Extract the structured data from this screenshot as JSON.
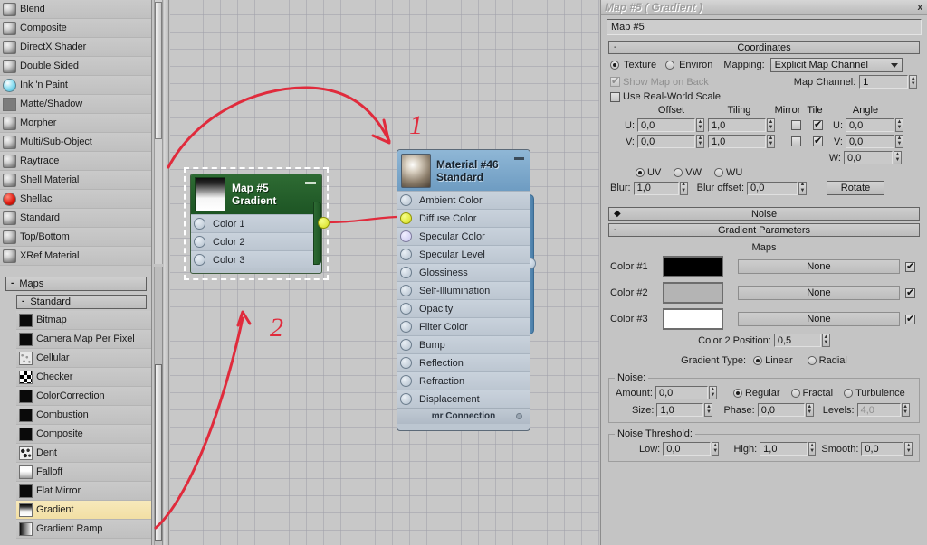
{
  "browser": {
    "materials": [
      {
        "label": "Blend",
        "icon": "sphere-swatch-icon",
        "type": "sphere"
      },
      {
        "label": "Composite",
        "icon": "sphere-swatch-icon",
        "type": "sphere"
      },
      {
        "label": "DirectX Shader",
        "icon": "sphere-swatch-icon",
        "type": "sphere"
      },
      {
        "label": "Double Sided",
        "icon": "sphere-swatch-icon",
        "type": "sphere"
      },
      {
        "label": "Ink 'n Paint",
        "icon": "blue-sphere-swatch-icon",
        "type": "sphere-blue"
      },
      {
        "label": "Matte/Shadow",
        "icon": "gray-swatch-icon",
        "type": "flat-gray"
      },
      {
        "label": "Morpher",
        "icon": "sphere-swatch-icon",
        "type": "sphere"
      },
      {
        "label": "Multi/Sub-Object",
        "icon": "sphere-swatch-icon",
        "type": "sphere"
      },
      {
        "label": "Raytrace",
        "icon": "sphere-swatch-icon",
        "type": "sphere"
      },
      {
        "label": "Shell Material",
        "icon": "sphere-swatch-icon",
        "type": "sphere"
      },
      {
        "label": "Shellac",
        "icon": "red-sphere-swatch-icon",
        "type": "red"
      },
      {
        "label": "Standard",
        "icon": "sphere-swatch-icon",
        "type": "sphere"
      },
      {
        "label": "Top/Bottom",
        "icon": "sphere-swatch-icon",
        "type": "sphere"
      },
      {
        "label": "XRef Material",
        "icon": "sphere-swatch-icon",
        "type": "sphere"
      }
    ],
    "maps_rollout": "Maps",
    "standard_rollout": "Standard",
    "maps": [
      {
        "label": "Bitmap",
        "icon": "black-swatch-icon",
        "type": "black",
        "selected": false
      },
      {
        "label": "Camera Map Per Pixel",
        "icon": "black-swatch-icon",
        "type": "black",
        "selected": false
      },
      {
        "label": "Cellular",
        "icon": "cellular-swatch-icon",
        "type": "cellular",
        "selected": false
      },
      {
        "label": "Checker",
        "icon": "checker-swatch-icon",
        "type": "checker",
        "selected": false
      },
      {
        "label": "ColorCorrection",
        "icon": "black-swatch-icon",
        "type": "black",
        "selected": false
      },
      {
        "label": "Combustion",
        "icon": "black-swatch-icon",
        "type": "black",
        "selected": false
      },
      {
        "label": "Composite",
        "icon": "black-swatch-icon",
        "type": "black",
        "selected": false
      },
      {
        "label": "Dent",
        "icon": "dent-swatch-icon",
        "type": "dent",
        "selected": false
      },
      {
        "label": "Falloff",
        "icon": "falloff-swatch-icon",
        "type": "falloff",
        "selected": false
      },
      {
        "label": "Flat Mirror",
        "icon": "black-swatch-icon",
        "type": "black",
        "selected": false
      },
      {
        "label": "Gradient",
        "icon": "gradient-swatch-icon",
        "type": "gradient",
        "selected": true
      },
      {
        "label": "Gradient Ramp",
        "icon": "gradient-ramp-swatch-icon",
        "type": "gradramp",
        "selected": false
      }
    ]
  },
  "graph": {
    "map_node": {
      "title_line1": "Map #5",
      "title_line2": "Gradient",
      "slots": [
        "Color 1",
        "Color 2",
        "Color 3"
      ]
    },
    "material_node": {
      "title_line1": "Material #46",
      "title_line2": "Standard",
      "slots": [
        "Ambient Color",
        "Diffuse Color",
        "Specular Color",
        "Specular Level",
        "Glossiness",
        "Self-Illumination",
        "Opacity",
        "Filter Color",
        "Bump",
        "Reflection",
        "Refraction",
        "Displacement"
      ],
      "footer": "mr Connection"
    },
    "annotations": [
      {
        "label": "1"
      },
      {
        "label": "2"
      }
    ],
    "annotation_color": "#e02b3c"
  },
  "params": {
    "window_title": "Map #5  ( Gradient )",
    "close_label": "x",
    "name_value": "Map #5",
    "coordinates": {
      "rollout": "Coordinates",
      "texture": "Texture",
      "environ": "Environ",
      "mapping_label": "Mapping:",
      "mapping_value": "Explicit Map Channel",
      "show_map_on_back": "Show Map on Back",
      "map_channel_label": "Map Channel:",
      "map_channel_value": "1",
      "use_real_world_scale": "Use Real-World Scale",
      "offset_header": "Offset",
      "tiling_header": "Tiling",
      "mirror_header": "Mirror",
      "tile_header": "Tile",
      "angle_header": "Angle",
      "u_label": "U:",
      "v_label": "V:",
      "w_label": "W:",
      "offset_u": "0,0",
      "offset_v": "0,0",
      "tiling_u": "1,0",
      "tiling_v": "1,0",
      "angle_u": "0,0",
      "angle_v": "0,0",
      "angle_w": "0,0",
      "mirror_u": false,
      "mirror_v": false,
      "tile_u": true,
      "tile_v": true,
      "uv": "UV",
      "vw": "VW",
      "wu": "WU",
      "axis_selected": "UV",
      "blur_label": "Blur:",
      "blur_value": "1,0",
      "blur_offset_label": "Blur offset:",
      "blur_offset_value": "0,0",
      "rotate_button": "Rotate"
    },
    "noise_rollout": "Noise",
    "gradient_rollout": "Gradient Parameters",
    "gradient": {
      "maps_header": "Maps",
      "color1_label": "Color #1",
      "color2_label": "Color #2",
      "color3_label": "Color #3",
      "color1_hex": "#000000",
      "color2_hex": "#b4b4b4",
      "color3_hex": "#ffffff",
      "map1": "None",
      "map2": "None",
      "map3": "None",
      "map1_on": true,
      "map2_on": true,
      "map3_on": true,
      "color2_position_label": "Color 2 Position:",
      "color2_position_value": "0,5",
      "gradient_type_label": "Gradient Type:",
      "linear": "Linear",
      "radial": "Radial",
      "gradient_type_selected": "Linear"
    },
    "noise": {
      "group_title": "Noise:",
      "amount_label": "Amount:",
      "amount_value": "0,0",
      "regular": "Regular",
      "fractal": "Fractal",
      "turbulence": "Turbulence",
      "noise_type_selected": "Regular",
      "size_label": "Size:",
      "size_value": "1,0",
      "phase_label": "Phase:",
      "phase_value": "0,0",
      "levels_label": "Levels:",
      "levels_value": "4,0"
    },
    "noise_threshold": {
      "group_title": "Noise Threshold:",
      "low_label": "Low:",
      "low_value": "0,0",
      "high_label": "High:",
      "high_value": "1,0",
      "smooth_label": "Smooth:",
      "smooth_value": "0,0"
    }
  }
}
